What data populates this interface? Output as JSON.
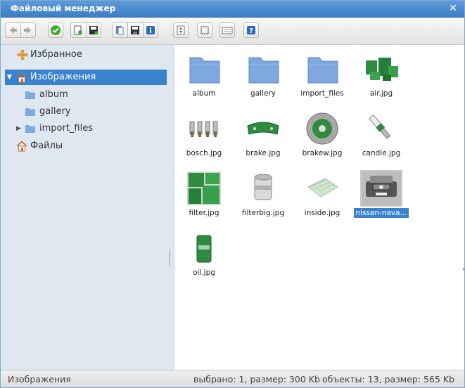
{
  "window": {
    "title": "Файловый менеджер",
    "close_glyph": "✕"
  },
  "toolbar": {
    "buttons": [
      {
        "name": "back-button",
        "icon": "arrow-left-icon"
      },
      {
        "name": "forward-button",
        "icon": "arrow-right-icon"
      },
      {
        "name": "select-button",
        "icon": "check-circle-icon"
      },
      {
        "name": "new-file-button",
        "icon": "new-file-icon"
      },
      {
        "name": "save-button",
        "icon": "save-icon"
      },
      {
        "name": "copy-button",
        "icon": "copy-icon"
      },
      {
        "name": "save-as-button",
        "icon": "disk-icon"
      },
      {
        "name": "info-button",
        "icon": "info-icon"
      },
      {
        "name": "sort-button",
        "icon": "sort-icon"
      },
      {
        "name": "select-area-button",
        "icon": "select-area-icon"
      },
      {
        "name": "view-mode-button",
        "icon": "keyboard-icon"
      },
      {
        "name": "help-button",
        "icon": "help-icon"
      }
    ]
  },
  "sidebar": {
    "favorites_label": "Избранное",
    "images_label": "Изображения",
    "children": [
      "album",
      "gallery",
      "import_files"
    ],
    "files_label": "Файлы"
  },
  "files": [
    {
      "name": "album",
      "type": "folder"
    },
    {
      "name": "gallery",
      "type": "folder"
    },
    {
      "name": "import_files",
      "type": "folder"
    },
    {
      "name": "air.jpg",
      "type": "image"
    },
    {
      "name": "bosch.jpg",
      "type": "image"
    },
    {
      "name": "brake.jpg",
      "type": "image"
    },
    {
      "name": "brakew.jpg",
      "type": "image"
    },
    {
      "name": "candle.jpg",
      "type": "image"
    },
    {
      "name": "filter.jpg",
      "type": "image"
    },
    {
      "name": "filterbig.jpg",
      "type": "image"
    },
    {
      "name": "inside.jpg",
      "type": "image"
    },
    {
      "name": "nissan-nava...",
      "type": "image",
      "selected": true
    },
    {
      "name": "oil.jpg",
      "type": "image"
    }
  ],
  "status": {
    "path": "Изображения",
    "selection": "выбрано: 1, размер: 300 Kb",
    "totals": "объекты: 13, размер: 565 Kb"
  },
  "colors": {
    "accent": "#3a82cf",
    "sidebar_bg": "#dfe8f1",
    "title_bg": "#4a89cc",
    "folder": "#7fa9de",
    "part_green": "#2e8b3f"
  }
}
